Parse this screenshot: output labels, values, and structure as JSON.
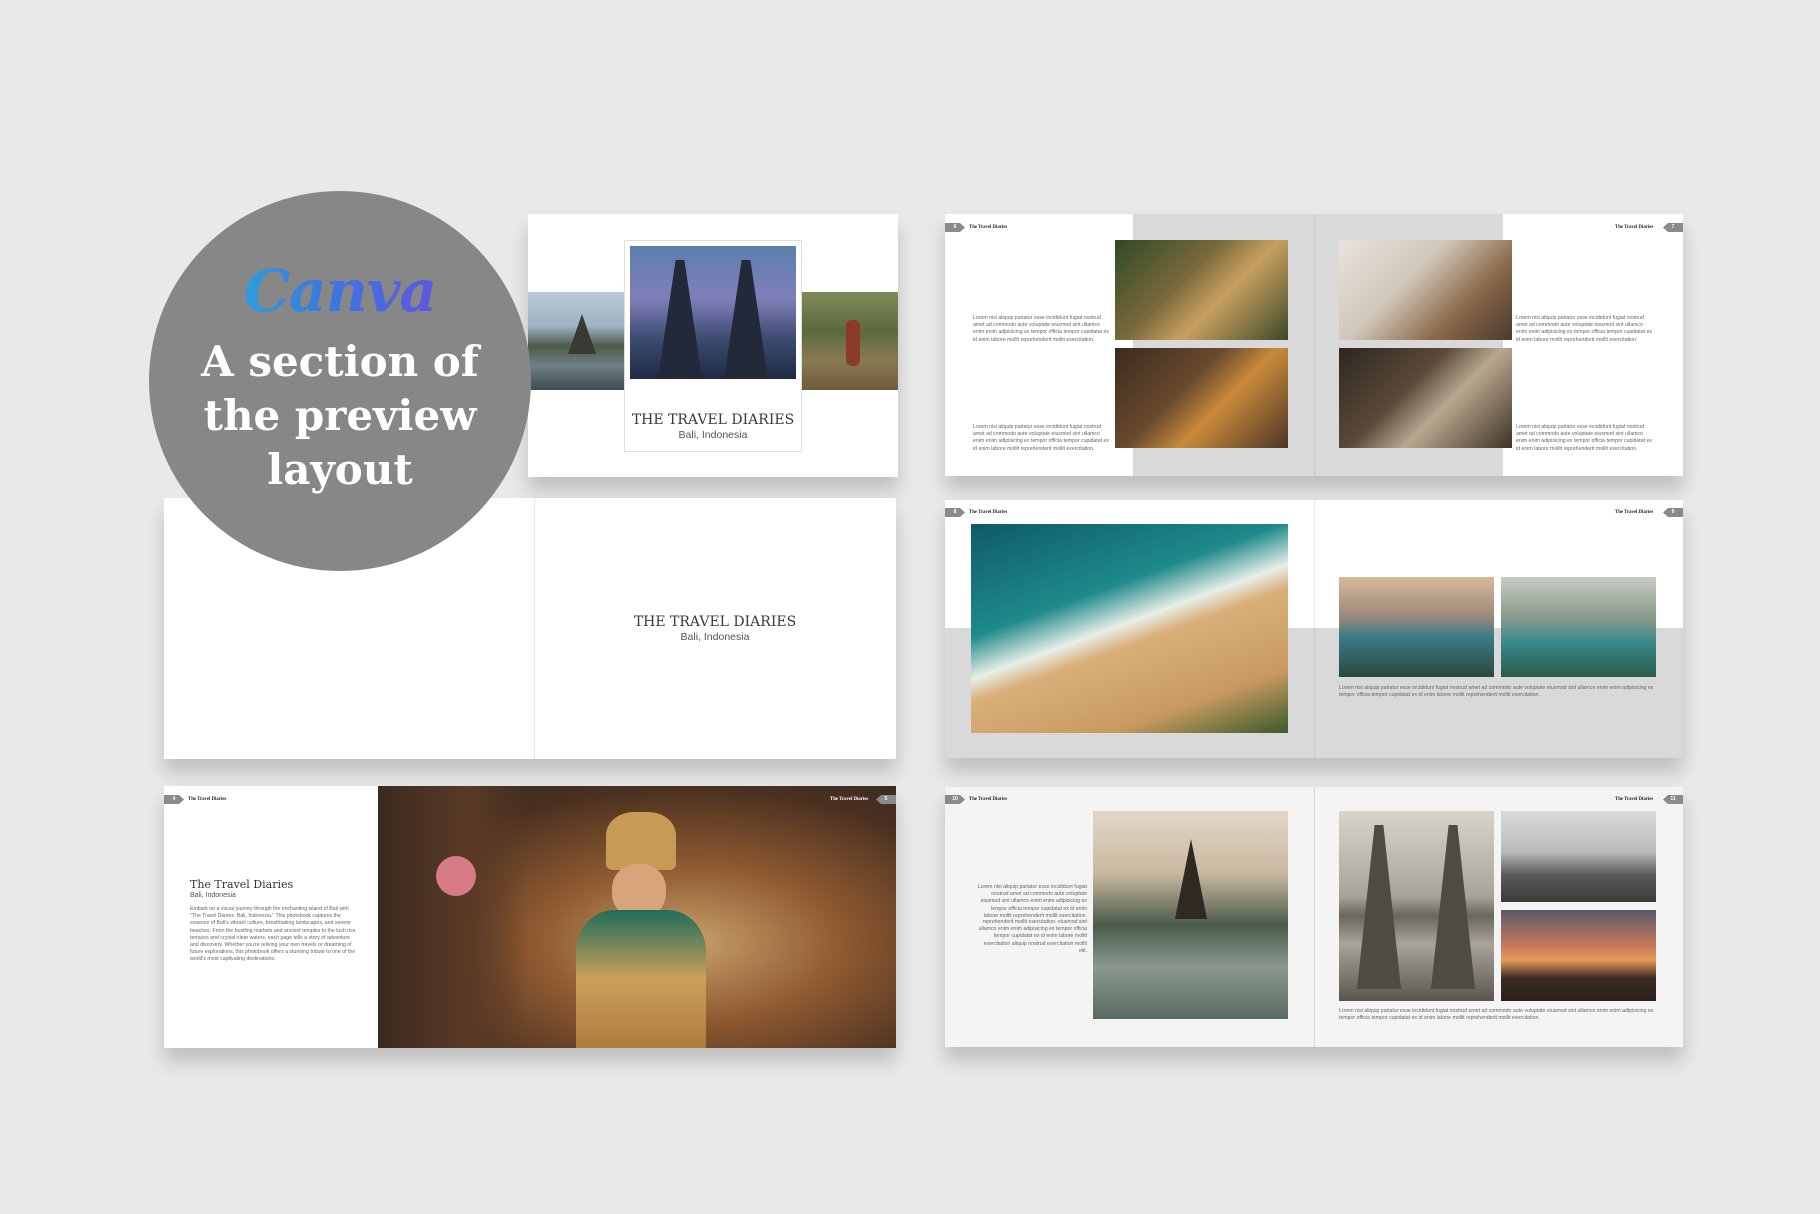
{
  "badge": {
    "brand": "Canva",
    "line1": "A section of",
    "line2": "the preview",
    "line3": "layout"
  },
  "book": {
    "title_caps": "THE TRAVEL DIARIES",
    "title": "The Travel Diaries",
    "subtitle": "Bali, Indonesia",
    "intro": "Embark on a visual journey through the enchanting island of Bali with \"The Travel Diaries: Bali, Indonesia.\" This photobook captures the essence of Bali's vibrant culture, breathtaking landscapes, and serene beaches. From the bustling markets and ancient temples to the lush rice terraces and crystal-clear waters, each page tells a story of adventure and discovery. Whether you're reliving your own travels or dreaming of future explorations, this photobook offers a stunning tribute to one of the world's most captivating destinations.",
    "lorem_a": "Lorem nisi aliquip pariatur esse incididunt fugiat nostrud amet ad commodo aute voluptate eiusmod sint ullamco enim enim adipisicing ex tempor officia tempor cupidatat ex id enim labore mollit reprehenderit mollit exercitation.",
    "lorem_b": "Lorem nisi aliquip pariatur esse incididunt fugiat nostrud amet ad commodo aute voluptate eiusmod sint ullamco enim enim adipisicing ex tempor officia tempor cupidatat ex id enim labore mollit reprehenderit mollit exercitation.",
    "lorem_c": "reprehenderit mollit exercitation. eiusmod sint ullamco enim enim adipisicing ex tempor officia tempor cupidatat ex id enim labore mollit exercitation aliquip nostrud exercitation mollit elit.",
    "lorem_wide": "Lorem nisi aliquip pariatur esse incididunt fugiat nostrud amet ad commodo aute voluptate eiusmod sint ullamco enim enim adipisicing ex tempor officia tempor cupidatat ex id enim labore mollit reprehenderit mollit exercitation.",
    "pages": {
      "p4": "4",
      "p5": "5",
      "p6": "6",
      "p7": "7",
      "p8": "8",
      "p9": "9",
      "p10": "10",
      "p11": "11"
    }
  }
}
